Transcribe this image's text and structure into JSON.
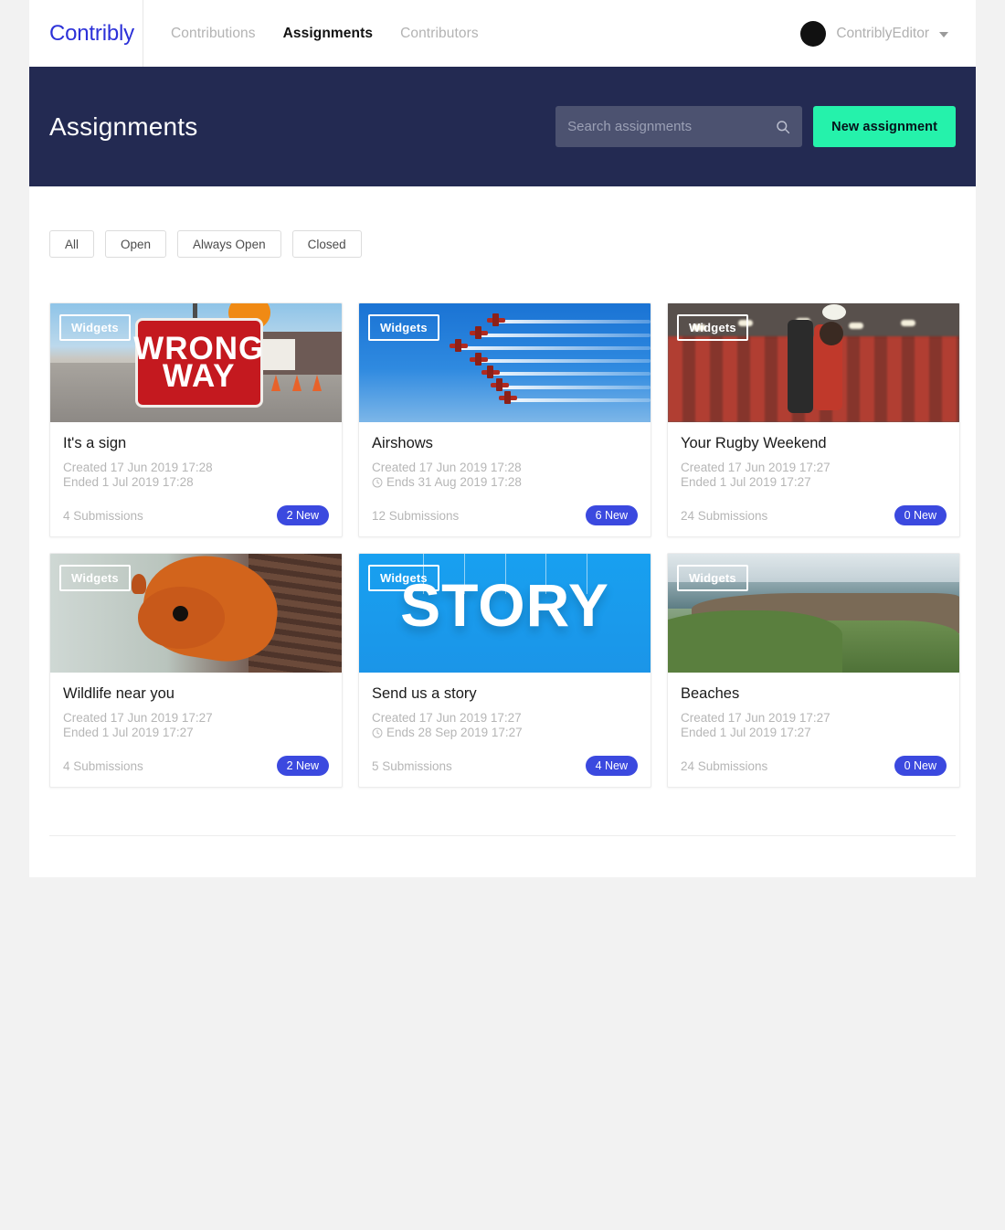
{
  "navbar": {
    "brand": "Contribly",
    "links": [
      {
        "label": "Contributions",
        "active": false
      },
      {
        "label": "Assignments",
        "active": true
      },
      {
        "label": "Contributors",
        "active": false
      }
    ],
    "user": {
      "name": "ContriblyEditor",
      "avatar_icon": "avatar-circle",
      "caret_icon": "chevron-down-icon"
    }
  },
  "hero": {
    "title": "Assignments",
    "search": {
      "placeholder": "Search assignments",
      "value": "",
      "icon": "search-icon"
    },
    "new_button": "New assignment",
    "bg_color": "#232a52",
    "accent_color": "#25f2ab"
  },
  "filters": [
    {
      "label": "All"
    },
    {
      "label": "Open"
    },
    {
      "label": "Always Open"
    },
    {
      "label": "Closed"
    }
  ],
  "badge_color": "#3b49df",
  "cards": [
    {
      "tag": "Widgets",
      "title": "It's a sign",
      "created": "Created 17 Jun 2019 17:28",
      "end": "Ended 1 Jul 2019 17:28",
      "has_clock": false,
      "submissions": "4 Submissions",
      "new_badge": "2 New",
      "image": "wrong-way-sign",
      "image_text_1": "WRONG",
      "image_text_2": "WAY"
    },
    {
      "tag": "Widgets",
      "title": "Airshows",
      "created": "Created 17 Jun 2019 17:28",
      "end": "Ends 31 Aug 2019 17:28",
      "has_clock": true,
      "submissions": "12 Submissions",
      "new_badge": "6 New",
      "image": "airshow-jets"
    },
    {
      "tag": "Widgets",
      "title": "Your Rugby Weekend",
      "created": "Created 17 Jun 2019 17:27",
      "end": "Ended 1 Jul 2019 17:27",
      "has_clock": false,
      "submissions": "24 Submissions",
      "new_badge": "0 New",
      "image": "rugby-lineout"
    },
    {
      "tag": "Widgets",
      "title": "Wildlife near you",
      "created": "Created 17 Jun 2019 17:27",
      "end": "Ended 1 Jul 2019 17:27",
      "has_clock": false,
      "submissions": "4 Submissions",
      "new_badge": "2 New",
      "image": "red-squirrel"
    },
    {
      "tag": "Widgets",
      "title": "Send us a story",
      "created": "Created 17 Jun 2019 17:27",
      "end": "Ends 28 Sep 2019 17:27",
      "has_clock": true,
      "submissions": "5 Submissions",
      "new_badge": "4 New",
      "image": "story-letters",
      "image_text_1": "STORY"
    },
    {
      "tag": "Widgets",
      "title": "Beaches",
      "created": "Created 17 Jun 2019 17:27",
      "end": "Ended 1 Jul 2019 17:27",
      "has_clock": false,
      "submissions": "24 Submissions",
      "new_badge": "0 New",
      "image": "coastal-cliffs"
    }
  ]
}
